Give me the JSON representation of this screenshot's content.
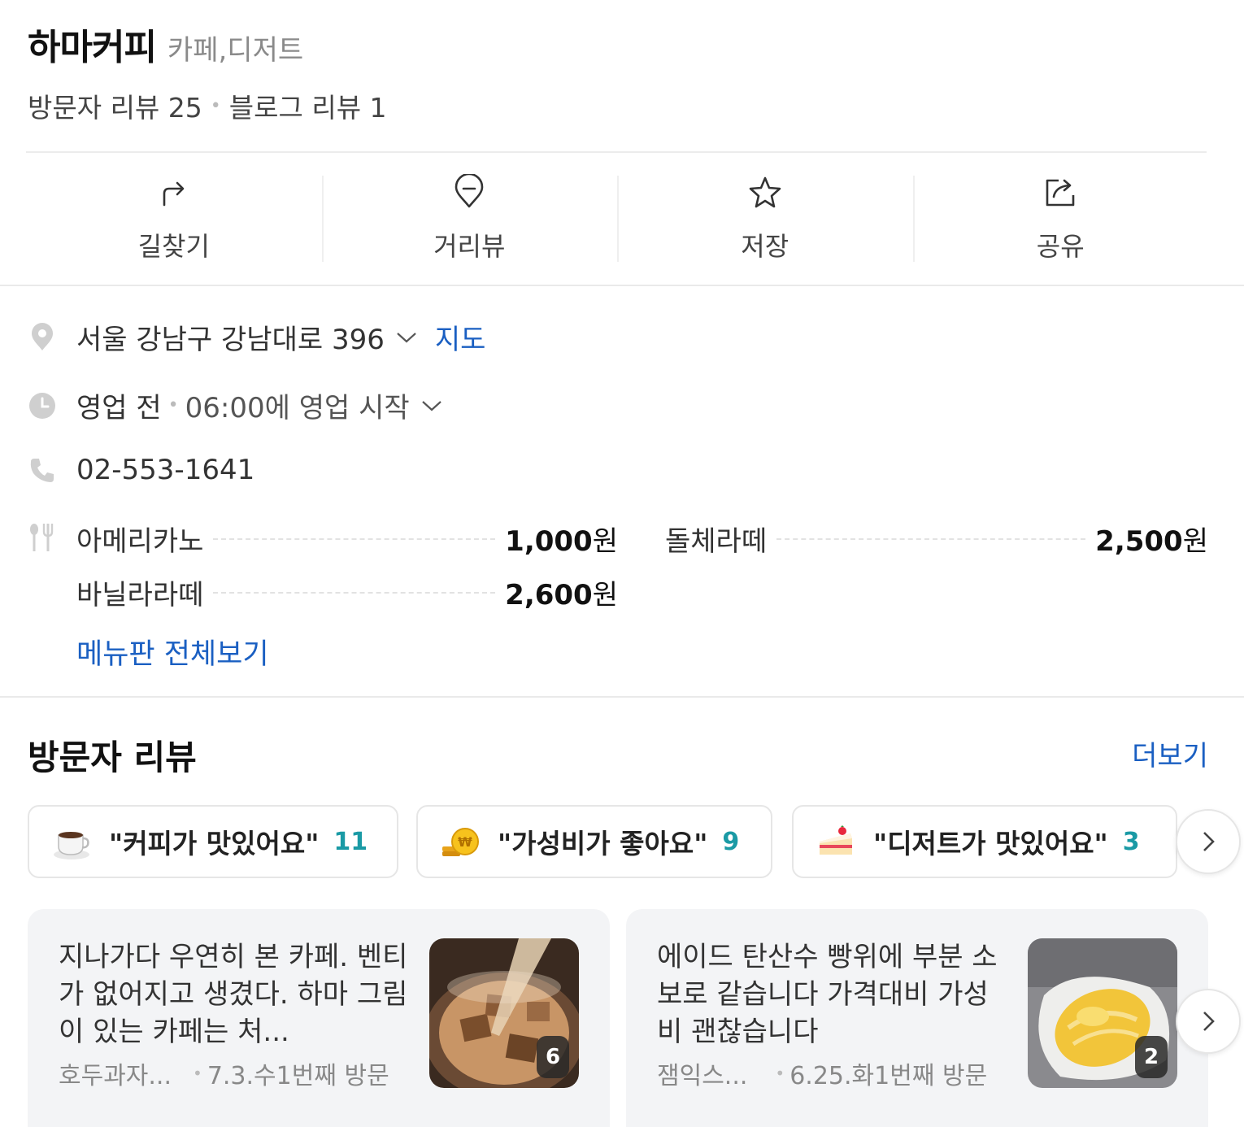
{
  "place": {
    "name": "하마커피",
    "category": "카페,디저트",
    "visitor_review_label": "방문자 리뷰 25",
    "blog_review_label": "블로그 리뷰 1"
  },
  "actions": [
    {
      "label": "길찾기",
      "icon": "directions-icon"
    },
    {
      "label": "거리뷰",
      "icon": "pin-outline-icon"
    },
    {
      "label": "저장",
      "icon": "star-icon"
    },
    {
      "label": "공유",
      "icon": "share-icon"
    }
  ],
  "info": {
    "address": "서울 강남구 강남대로 396",
    "map_link": "지도",
    "status": "영업 전",
    "hours": "06:00에 영업 시작",
    "phone": "02-553-1641"
  },
  "menu": {
    "items": [
      {
        "name": "아메리카노",
        "price": "1,000",
        "unit": "원"
      },
      {
        "name": "돌체라떼",
        "price": "2,500",
        "unit": "원"
      },
      {
        "name": "바닐라라떼",
        "price": "2,600",
        "unit": "원"
      }
    ],
    "view_all": "메뉴판 전체보기"
  },
  "reviews": {
    "title": "방문자 리뷰",
    "more": "더보기",
    "keywords": [
      {
        "text": "\"커피가 맛있어요\"",
        "count": "11",
        "icon": "coffee-cup-icon"
      },
      {
        "text": "\"가성비가 좋아요\"",
        "count": "9",
        "icon": "coins-icon"
      },
      {
        "text": "\"디저트가 맛있어요\"",
        "count": "3",
        "icon": "cake-icon"
      }
    ],
    "cards": [
      {
        "text": "지나가다 우연히 본 카페. 벤티가 없어지고 생겼다. 하마 그림이 있는 카페는 처...",
        "author": "호두과자...",
        "date": "7.3.수",
        "visit": "1번째 방문",
        "photo_count": "6"
      },
      {
        "text": "에이드 탄산수 빵위에 부분 소보로 같습니다 가격대비 가성비 괜찮습니다",
        "author": "잼익스...",
        "date": "6.25.화",
        "visit": "1번째 방문",
        "photo_count": "2"
      }
    ]
  },
  "colors": {
    "link": "#1a5fc2",
    "count": "#1a9aa5"
  }
}
